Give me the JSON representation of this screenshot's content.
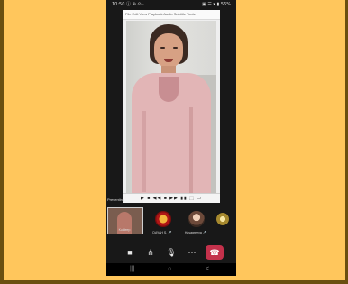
{
  "status_bar": {
    "time": "10:50 ⓘ ⊕ ⊙ ·",
    "right_icons": "▣ ☰ ▾ ▮ 56%"
  },
  "share_window": {
    "title": "File  Edit  View  Playback  Audio  Subtitle  Tools"
  },
  "player": {
    "controls": "▶ ■ ◀◀ ■ ▶▶ ▮▮ ⬚ ▭"
  },
  "presenter": {
    "label": "Presenting"
  },
  "participants": [
    {
      "name": "Kuldeep",
      "icon": "self-video"
    },
    {
      "name": "DAYAH S. 🎤",
      "icon": "logo-avatar"
    },
    {
      "name": "Hayagreeva 🎤",
      "icon": "person-avatar"
    },
    {
      "name": "",
      "icon": "emblem-avatar"
    }
  ],
  "controls": {
    "camera": "■",
    "mute_video": "⋔",
    "mic": "🎙",
    "more": "···",
    "end": "☎"
  },
  "nav": {
    "recents": "|||",
    "home": "○",
    "back": "<"
  },
  "colors": {
    "background": "#ffc65c",
    "end_call": "#c4314b",
    "phone": "#181818"
  }
}
